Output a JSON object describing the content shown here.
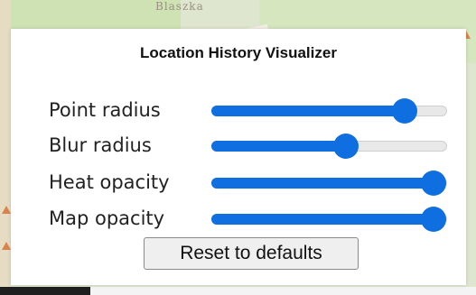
{
  "map": {
    "place_label": "Blaszka",
    "colors": {
      "land": "#dfe6cf",
      "forest": "#cfe2b4",
      "marker": "#d9844a"
    }
  },
  "panel": {
    "title": "Location History Visualizer",
    "sliders": [
      {
        "label": "Point radius",
        "value_fraction": 0.86
      },
      {
        "label": "Blur radius",
        "value_fraction": 0.58
      },
      {
        "label": "Heat opacity",
        "value_fraction": 1.0
      },
      {
        "label": "Map opacity",
        "value_fraction": 1.0
      }
    ],
    "reset_label": "Reset to defaults",
    "accent_color": "#0f6fe0"
  }
}
